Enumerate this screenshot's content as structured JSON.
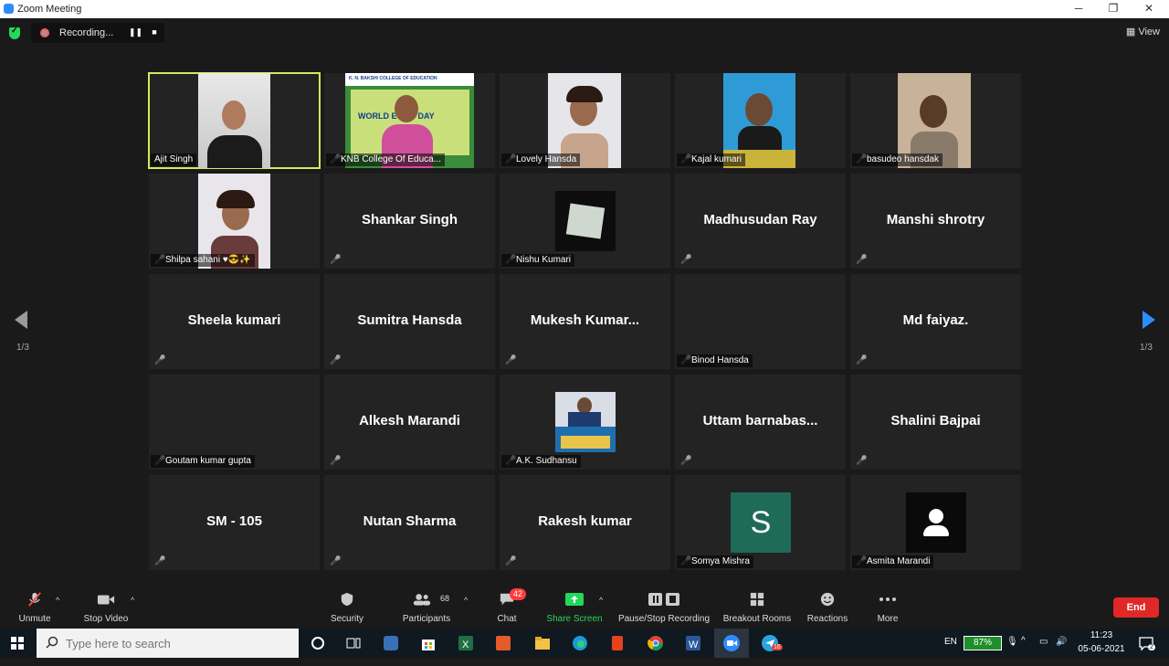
{
  "window": {
    "title": "Zoom Meeting",
    "minimize": "─",
    "maximize": "❐",
    "close": "✕"
  },
  "recording": {
    "label": "Recording...",
    "pause": "❚❚",
    "stop": "■"
  },
  "view": {
    "label": "View"
  },
  "pager": {
    "left": "1/3",
    "right": "1/3"
  },
  "tiles": [
    {
      "name": "Ajit Singh",
      "big": "",
      "active": true
    },
    {
      "name": "KNB College Of Educa...",
      "big": ""
    },
    {
      "name": "Lovely Hansda",
      "big": ""
    },
    {
      "name": "Kajal kumari",
      "big": ""
    },
    {
      "name": "basudeo hansdak",
      "big": ""
    },
    {
      "name": "Shilpa sahani ♥😎✨",
      "big": ""
    },
    {
      "name": "",
      "big": "Shankar Singh"
    },
    {
      "name": "Nishu Kumari",
      "big": ""
    },
    {
      "name": "",
      "big": "Madhusudan Ray"
    },
    {
      "name": "",
      "big": "Manshi shrotry"
    },
    {
      "name": "",
      "big": "Sheela kumari"
    },
    {
      "name": "",
      "big": "Sumitra Hansda"
    },
    {
      "name": "",
      "big": "Mukesh  Kumar..."
    },
    {
      "name": "Binod Hansda",
      "big": ""
    },
    {
      "name": "",
      "big": "Md faiyaz."
    },
    {
      "name": "Goutam kumar gupta",
      "big": ""
    },
    {
      "name": "",
      "big": "Alkesh Marandi"
    },
    {
      "name": "A.K. Sudhansu",
      "big": ""
    },
    {
      "name": "",
      "big": "Uttam  barnabas..."
    },
    {
      "name": "",
      "big": "Shalini Bajpai"
    },
    {
      "name": "",
      "big": "SM - 105"
    },
    {
      "name": "",
      "big": "Nutan Sharma"
    },
    {
      "name": "",
      "big": "Rakesh kumar"
    },
    {
      "name": "Somya Mishra",
      "big": "",
      "avatar_letter": "S"
    },
    {
      "name": "Asmita Marandi",
      "big": ""
    }
  ],
  "banner": {
    "college": "K. N. BAKSHI COLLEGE OF EDUCATION",
    "event": "WORLD E   ENT DAY"
  },
  "toolbar": {
    "unmute": "Unmute",
    "stop_video": "Stop Video",
    "security": "Security",
    "participants": "Participants",
    "participants_count": "68",
    "chat": "Chat",
    "chat_badge": "42",
    "share_screen": "Share Screen",
    "pause_stop_recording": "Pause/Stop Recording",
    "breakout_rooms": "Breakout Rooms",
    "reactions": "Reactions",
    "more": "More",
    "end": "End"
  },
  "taskbar": {
    "search_placeholder": "Type here to search",
    "lang": "EN",
    "battery": "87%",
    "time": "11:23",
    "date": "05-06-2021",
    "telegram_badge": "16",
    "notif_badge": "2"
  },
  "colors": {
    "active_speaker": "#d4ea5a",
    "share_green": "#23d959",
    "end_red": "#e02828",
    "muted_red": "#ff4b4b"
  }
}
